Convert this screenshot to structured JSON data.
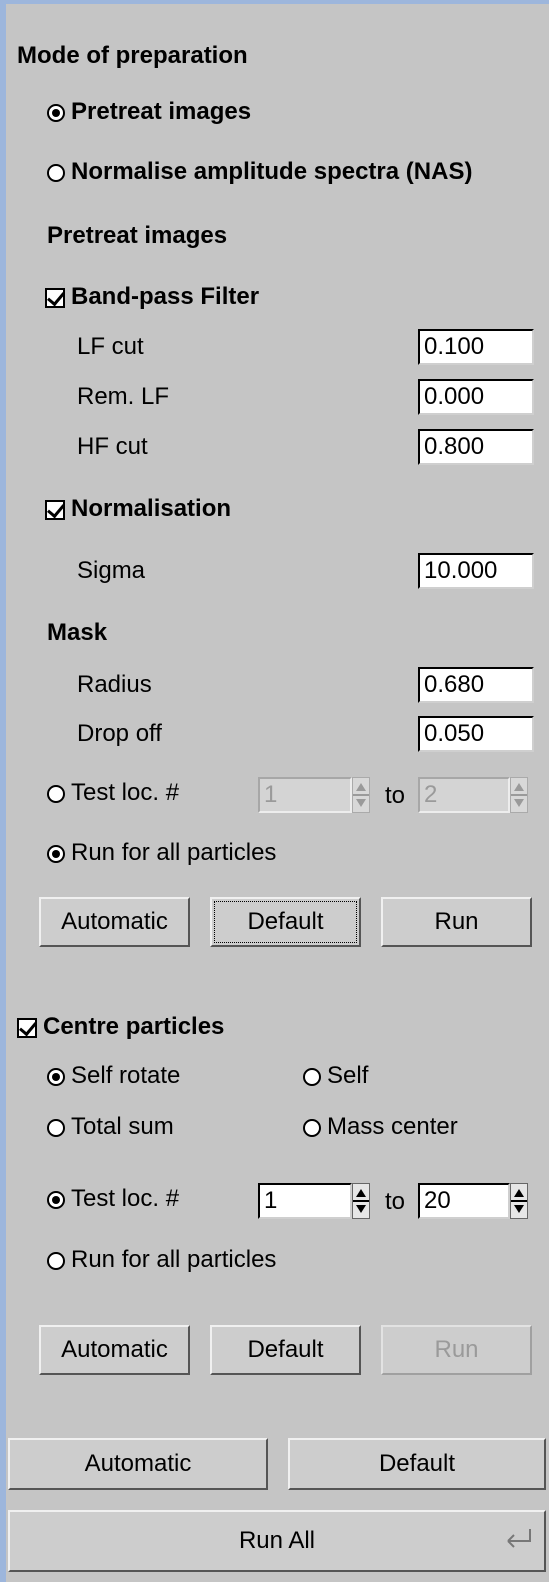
{
  "mode": {
    "title": "Mode of preparation",
    "options": [
      {
        "label": "Pretreat images",
        "selected": true
      },
      {
        "label": "Normalise amplitude spectra (NAS)",
        "selected": false
      }
    ]
  },
  "pretreat": {
    "title": "Pretreat images",
    "bandpass": {
      "label": "Band-pass Filter",
      "checked": true,
      "fields": [
        {
          "label": "LF cut",
          "value": "0.100"
        },
        {
          "label": "Rem. LF",
          "value": "0.000"
        },
        {
          "label": "HF cut",
          "value": "0.800"
        }
      ]
    },
    "normalisation": {
      "label": "Normalisation",
      "checked": true,
      "sigma_label": "Sigma",
      "sigma_value": "10.000"
    },
    "mask": {
      "title": "Mask",
      "radius_label": "Radius",
      "radius_value": "0.680",
      "dropoff_label": "Drop off",
      "dropoff_value": "0.050"
    },
    "test_loc": {
      "label": "Test loc. #",
      "selected": false,
      "from": "1",
      "to_label": "to",
      "to": "2"
    },
    "run_all_particles": {
      "label": "Run for all particles",
      "selected": true
    },
    "buttons": {
      "automatic": "Automatic",
      "default": "Default",
      "run": "Run"
    }
  },
  "centre": {
    "label": "Centre particles",
    "checked": true,
    "options": {
      "self_rotate": {
        "label": "Self rotate",
        "selected": true
      },
      "self": {
        "label": "Self",
        "selected": false
      },
      "total_sum": {
        "label": "Total sum",
        "selected": false
      },
      "mass_center": {
        "label": "Mass center",
        "selected": false
      }
    },
    "test_loc": {
      "label": "Test loc. #",
      "selected": true,
      "from": "1",
      "to_label": "to",
      "to": "20"
    },
    "run_all_particles": {
      "label": "Run for all particles",
      "selected": false
    },
    "buttons": {
      "automatic": "Automatic",
      "default": "Default",
      "run": "Run"
    }
  },
  "footer": {
    "automatic": "Automatic",
    "default": "Default",
    "run_all": "Run All",
    "run_all_icon": "enter-key-icon"
  }
}
